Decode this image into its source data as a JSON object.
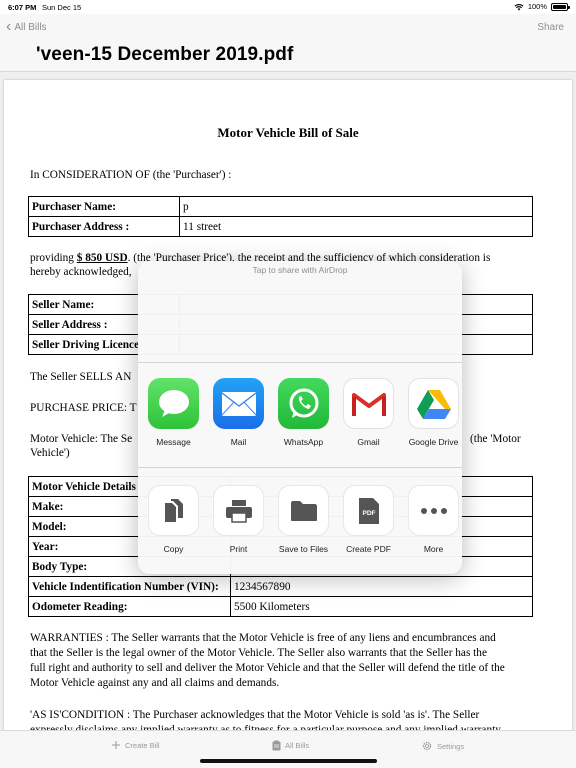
{
  "status_bar": {
    "time": "6:07 PM",
    "date": "Sun Dec 15",
    "battery": "100%"
  },
  "nav": {
    "back_label": "All Bills",
    "share_label": "Share",
    "title": "'veen-15 December 2019.pdf"
  },
  "doc": {
    "title": "Motor Vehicle Bill of Sale",
    "consideration": "In CONSIDERATION OF (the 'Purchaser') :",
    "purchaser_table": [
      {
        "key": "Purchaser Name:",
        "value": "p"
      },
      {
        "key": "Purchaser Address :",
        "value": "11 street"
      }
    ],
    "providing_prefix": "providing ",
    "price": "$ 850 USD",
    "providing_suffix": ". (the 'Purchaser Price'), the receipt and the sufficiency of which consideration is",
    "providing_line2": "hereby acknowledged,",
    "seller_table": [
      {
        "key": "Seller Name:",
        "value": ""
      },
      {
        "key": "Seller Address :",
        "value": ""
      },
      {
        "key": "Seller Driving Licence",
        "value": ""
      }
    ],
    "sells_line": "The Seller SELLS AN",
    "purchase_price_line": "PURCHASE PRICE: T",
    "motor_vehicle_line": "Motor Vehicle: The Se",
    "motor_vehicle_suffix": "(the 'Motor",
    "vehicle_line2": "Vehicle')",
    "vehicle_table": [
      {
        "key": "Motor Vehicle Details",
        "value": ""
      },
      {
        "key": "Make:",
        "value": ""
      },
      {
        "key": "Model:",
        "value": ""
      },
      {
        "key": "Year:",
        "value": ""
      },
      {
        "key": "Body Type:",
        "value": ""
      },
      {
        "key": "Vehicle Indentification Number (VIN):",
        "value": "1234567890"
      },
      {
        "key": "Odometer Reading:",
        "value": "5500 Kilometers"
      }
    ],
    "warranties": [
      "WARRANTIES : The Seller warrants that the Motor Vehicle is free of any liens and encumbrances and",
      "that the Seller is the legal owner of the Motor Vehicle. The Seller also warrants that the Seller has the",
      "full right and authority to sell and deliver the Motor Vehicle and that the Seller will defend the title of the",
      "Motor Vehicle against any and all claims and demands."
    ],
    "as_is": [
      "'AS IS'CONDITION : The Purchaser acknowledges that the Motor Vehicle is sold 'as is'. The Seller",
      "expressly disclaims any implied warranty as to fitness for a particular purpose and any implied warranty"
    ]
  },
  "share_sheet": {
    "airdrop_hint": "Tap to share with AirDrop",
    "apps": [
      {
        "label": "Message",
        "icon": "messages-icon"
      },
      {
        "label": "Mail",
        "icon": "mail-icon"
      },
      {
        "label": "WhatsApp",
        "icon": "whatsapp-icon"
      },
      {
        "label": "Gmail",
        "icon": "gmail-icon"
      },
      {
        "label": "Google Drive",
        "icon": "google-drive-icon"
      }
    ],
    "actions": [
      {
        "label": "Copy",
        "icon": "copy-icon"
      },
      {
        "label": "Print",
        "icon": "print-icon"
      },
      {
        "label": "Save to Files",
        "icon": "folder-icon"
      },
      {
        "label": "Create PDF",
        "icon": "pdf-icon"
      },
      {
        "label": "More",
        "icon": "more-icon"
      }
    ]
  },
  "tab_bar": [
    {
      "label": "Create Bill",
      "icon": "plus-icon"
    },
    {
      "label": "All Bills",
      "icon": "clipboard-icon"
    },
    {
      "label": "Settings",
      "icon": "gear-icon"
    }
  ]
}
